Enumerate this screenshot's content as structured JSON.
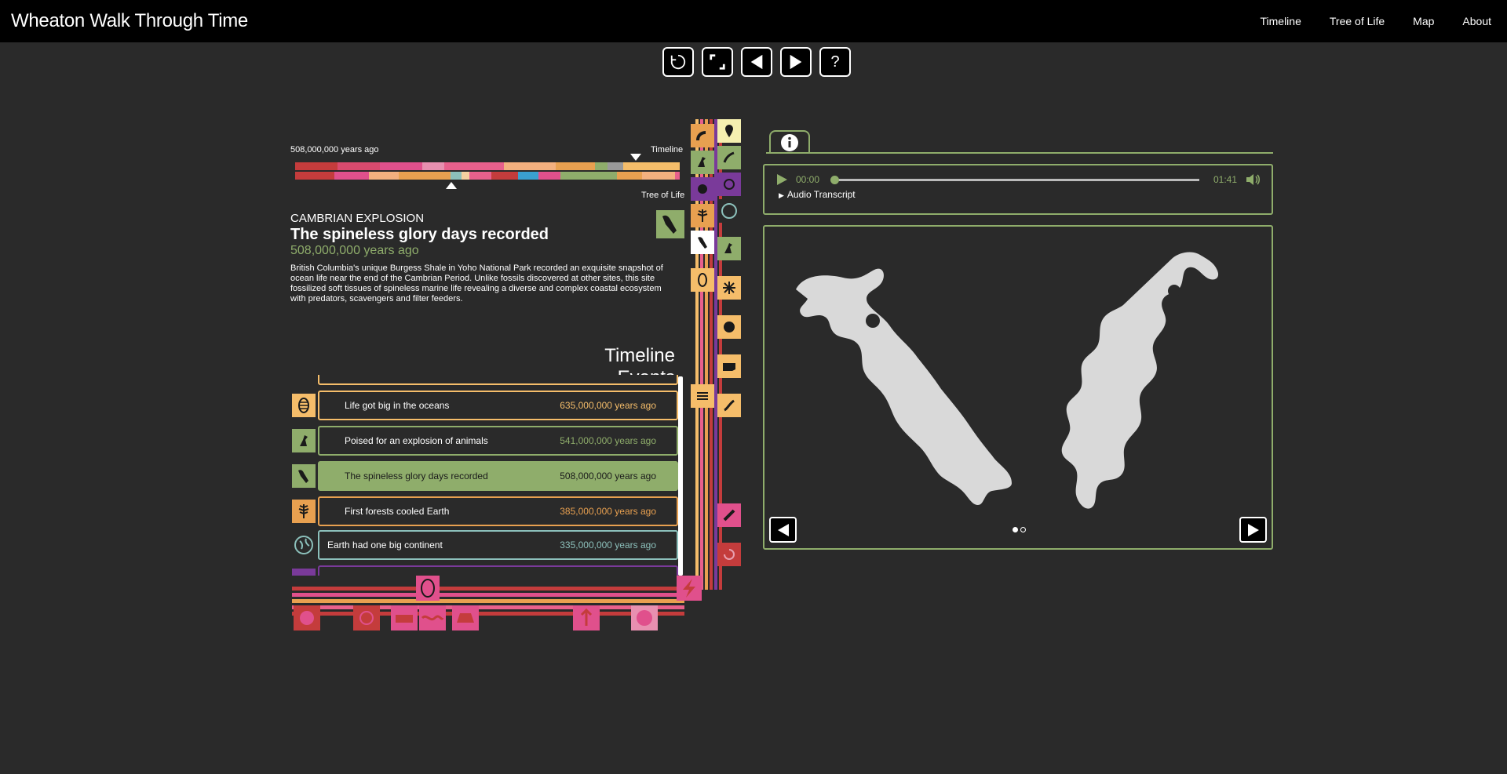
{
  "header": {
    "title": "Wheaton Walk Through Time",
    "nav": [
      "Timeline",
      "Tree of Life",
      "Map",
      "About"
    ]
  },
  "controls": {
    "restart": "restart-icon",
    "fullscreen": "fullscreen-icon",
    "prev": "prev-icon",
    "next": "next-icon",
    "help": "?"
  },
  "timeline_scale": {
    "current_label": "508,000,000 years ago",
    "timeline_label": "Timeline",
    "tree_label": "Tree of Life"
  },
  "event": {
    "era": "CAMBRIAN EXPLOSION",
    "title": "The spineless glory days recorded",
    "date": "508,000,000 years ago",
    "description": "British Columbia's unique Burgess Shale in Yoho National Park recorded an exquisite snapshot of ocean life near the end of the Cambrian Period. Unlike fossils discovered at other sites, this site fossilized soft tissues of spineless marine life revealing a diverse and complex coastal ecosystem with predators, scavengers and filter feeders."
  },
  "timeline_events": {
    "heading": "Timeline Events",
    "items": [
      {
        "label": "Life got big in the oceans",
        "date": "635,000,000 years ago",
        "color": "#f5bd6a",
        "bg": "#2a2a2a",
        "date_color": "#f5bd6a",
        "icon": "trilobite-icon"
      },
      {
        "label": "Poised for an explosion of animals",
        "date": "541,000,000 years ago",
        "color": "#8fad6b",
        "bg": "#2a2a2a",
        "date_color": "#8fad6b",
        "icon": "bird-icon"
      },
      {
        "label": "The spineless glory days recorded",
        "date": "508,000,000 years ago",
        "color": "#8fad6b",
        "bg": "#8fad6b",
        "date_color": "#1a1a1a",
        "icon": "anomalocaris-icon"
      },
      {
        "label": "First forests cooled Earth",
        "date": "385,000,000 years ago",
        "color": "#e8a050",
        "bg": "#2a2a2a",
        "date_color": "#e8a050",
        "icon": "fern-icon"
      },
      {
        "label": "Earth had one big continent",
        "date": "335,000,000 years ago",
        "color": "#8cc0bb",
        "bg": "#2a2a2a",
        "date_color": "#8cc0bb",
        "icon": "globe-icon"
      }
    ]
  },
  "audio": {
    "current_time": "00:00",
    "duration": "01:41",
    "progress": 0,
    "transcript_label": "Audio Transcript"
  },
  "gallery": {
    "slide_count": 2,
    "active_index": 0
  },
  "colors": {
    "accent_green": "#8fad6b",
    "orange": "#f5bd6a",
    "pink": "#e0508c",
    "red": "#c43c3c",
    "purple": "#7a3a9a"
  }
}
